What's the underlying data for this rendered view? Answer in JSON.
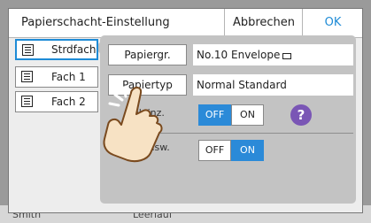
{
  "dialog": {
    "title": "Papierschacht-Einstellung",
    "cancel_label": "Abbrechen",
    "ok_label": "OK"
  },
  "trays": [
    {
      "label": "Strdfach",
      "selected": true
    },
    {
      "label": "Fach 1",
      "selected": false
    },
    {
      "label": "Fach 2",
      "selected": false
    }
  ],
  "settings": {
    "paper_size_label": "Papiergr.",
    "paper_size_value": "No.10 Envelope",
    "paper_type_label": "Papiertyp",
    "paper_type_value": "Normal Standard",
    "row3_label": "eleinz.",
    "row3_off": "OFF",
    "row3_on": "ON",
    "row3_state": "OFF",
    "row4_label": "Ausw.",
    "row4_off": "OFF",
    "row4_on": "ON",
    "row4_state": "ON",
    "help_icon": "?"
  },
  "background": {
    "left_text": "Smith",
    "middle_text": "Leerlauf"
  },
  "colors": {
    "accent": "#1e8bd6",
    "toggle_on": "#2b8ad8",
    "help": "#7a56b5",
    "panel": "#c3c3c3"
  }
}
